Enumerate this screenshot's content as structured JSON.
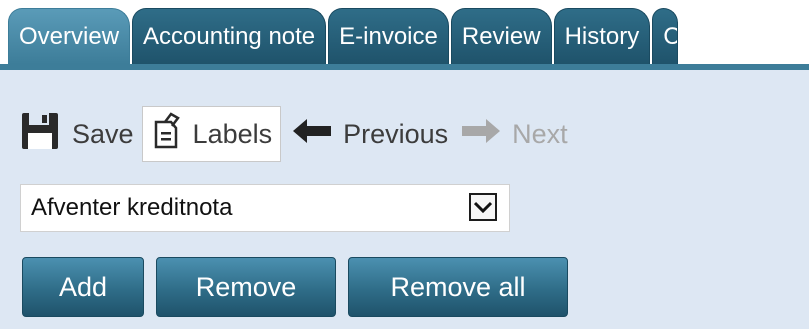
{
  "tabs": [
    {
      "label": "Overview",
      "active": true
    },
    {
      "label": "Accounting note"
    },
    {
      "label": "E-invoice"
    },
    {
      "label": "Review"
    },
    {
      "label": "History"
    },
    {
      "label": "C"
    }
  ],
  "toolbar": {
    "save_label": "Save",
    "labels_label": "Labels",
    "previous_label": "Previous",
    "next_label": "Next",
    "icons": {
      "save": "floppy-disk-icon",
      "labels": "tag-clipboard-icon",
      "previous": "arrow-left-icon",
      "next": "arrow-right-icon"
    }
  },
  "status_select": {
    "value": "Afventer kreditnota",
    "arrow_icon": "chevron-down-icon"
  },
  "actions": {
    "add_label": "Add",
    "remove_label": "Remove",
    "remove_all_label": "Remove all"
  },
  "colors": {
    "tab_dark": "#1f536b",
    "tab_active": "#3d7d99",
    "panel_bg": "#dde7f3",
    "disabled_text": "#a8a8a8"
  }
}
